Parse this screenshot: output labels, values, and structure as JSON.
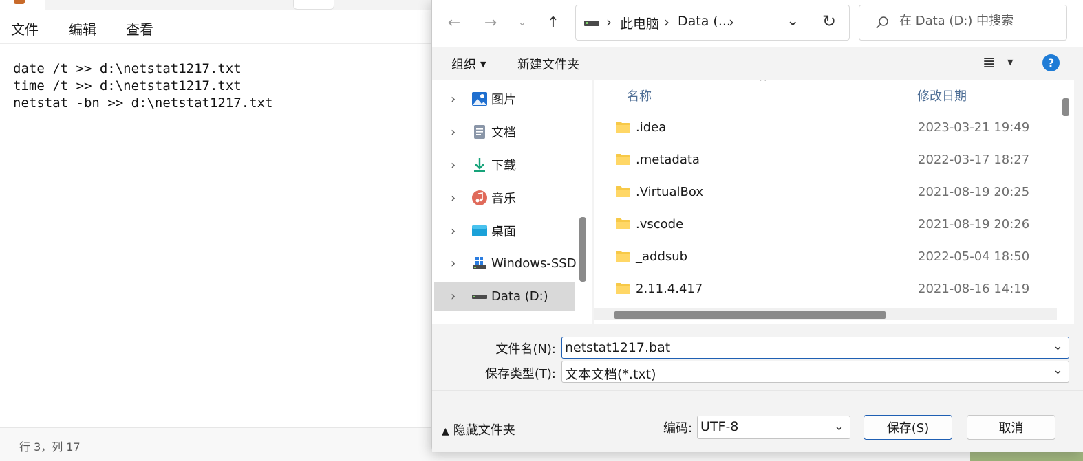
{
  "notepad": {
    "menu": [
      "文件",
      "编辑",
      "查看"
    ],
    "lines": [
      "date /t >> d:\\netstat1217.txt",
      "time /t >> d:\\netstat1217.txt",
      "netstat -bn >> d:\\netstat1217.txt"
    ],
    "status": "行 3，列 17"
  },
  "dialog": {
    "address": {
      "parts": [
        "此电脑",
        "Data (..."
      ],
      "separator": "›"
    },
    "search_placeholder": "在 Data (D:) 中搜索",
    "toolbar": {
      "organize": "组织",
      "new_folder": "新建文件夹"
    },
    "tree": [
      {
        "label": "图片",
        "icon": "pictures-icon"
      },
      {
        "label": "文档",
        "icon": "documents-icon"
      },
      {
        "label": "下载",
        "icon": "downloads-icon"
      },
      {
        "label": "音乐",
        "icon": "music-icon"
      },
      {
        "label": "桌面",
        "icon": "desktop-icon"
      },
      {
        "label": "Windows-SSD",
        "icon": "windows-drive-icon"
      },
      {
        "label": "Data (D:)",
        "icon": "drive-icon",
        "selected": true
      }
    ],
    "columns": {
      "name": "名称",
      "modified": "修改日期"
    },
    "files": [
      {
        "name": ".idea",
        "date": "2023-03-21 19:49"
      },
      {
        "name": ".metadata",
        "date": "2022-03-17 18:27"
      },
      {
        "name": ".VirtualBox",
        "date": "2021-08-19 20:25"
      },
      {
        "name": ".vscode",
        "date": "2021-08-19 20:26"
      },
      {
        "name": "_addsub",
        "date": "2022-05-04 18:50"
      },
      {
        "name": "2.11.4.417",
        "date": "2021-08-16 14:19"
      }
    ],
    "filename_label": "文件名(N):",
    "filename_value": "netstat1217.bat",
    "filetype_label": "保存类型(T):",
    "filetype_value": "文本文档(*.txt)",
    "hide_folders": "隐藏文件夹",
    "encoding_label": "编码:",
    "encoding_value": "UTF-8",
    "save": "保存(S)",
    "cancel": "取消"
  },
  "colors": {
    "accent": "#1f5fb3",
    "folder": "#f7c948",
    "help": "#1f7cd6"
  }
}
